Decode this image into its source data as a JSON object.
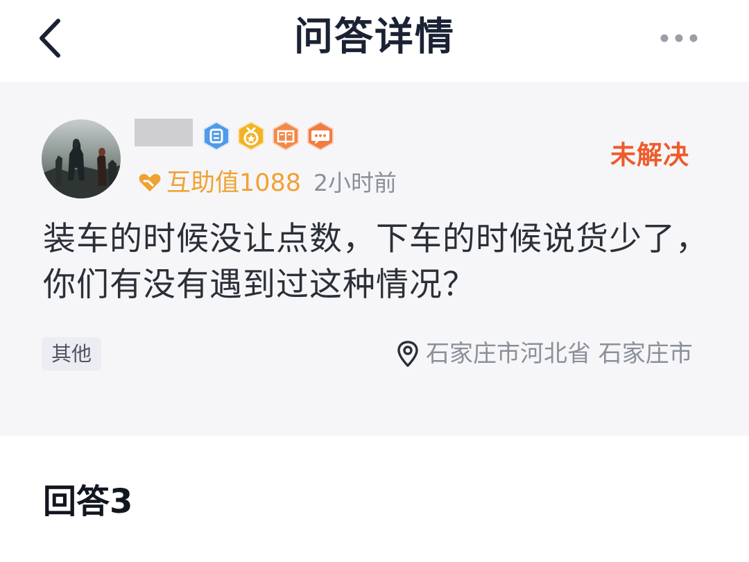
{
  "header": {
    "title": "问答详情",
    "back_icon": "chevron-left-icon",
    "more_icon": "more-dots-icon"
  },
  "question": {
    "status": "未解决",
    "help_value_label": "互助值1088",
    "time": "2小时前",
    "text": "装车的时候没让点数，下车的时候说货少了，你们有没有遇到过这种情况？",
    "tag": "其他",
    "location": "石家庄市河北省 石家庄市",
    "badges": [
      "level-badge-icon",
      "medal-badge-icon",
      "book-badge-icon",
      "chat-badge-icon"
    ]
  },
  "answers": {
    "title": "回答3"
  },
  "colors": {
    "status": "#ef5b2d",
    "help_value": "#f0a132",
    "card_bg": "#f6f6f8"
  }
}
